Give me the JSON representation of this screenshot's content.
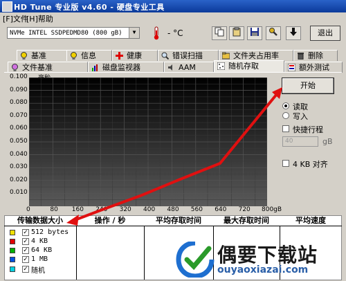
{
  "window": {
    "title": "HD Tune 专业版 v4.60 - 硬盘专业工具"
  },
  "menu": {
    "file": "[F]文件",
    "help": "[H]帮助"
  },
  "toolbar": {
    "drive": "NVMe   INTEL SSDPEDMD80 (800 gB)",
    "temperature": "- °C",
    "exit_label": "退出"
  },
  "tabs_row1": [
    {
      "label": "基准"
    },
    {
      "label": "信息"
    },
    {
      "label": "健康"
    },
    {
      "label": "错误扫描"
    },
    {
      "label": "文件夹占用率"
    },
    {
      "label": "删除"
    }
  ],
  "tabs_row2": [
    {
      "label": "文件基准"
    },
    {
      "label": "磁盘监视器"
    },
    {
      "label": "AAM"
    },
    {
      "label": "随机存取"
    },
    {
      "label": "额外测试"
    }
  ],
  "chart_data": {
    "type": "scatter",
    "ylabel": "毫秒",
    "xlabel": "",
    "y_ticks": [
      "0.100",
      "0.090",
      "0.080",
      "0.070",
      "0.060",
      "0.050",
      "0.040",
      "0.030",
      "0.020",
      "0.010"
    ],
    "x_ticks": [
      "0",
      "80",
      "160",
      "240",
      "320",
      "400",
      "480",
      "560",
      "640",
      "720",
      "800gB"
    ],
    "ylim": [
      0,
      0.1
    ],
    "xlim": [
      0,
      800
    ],
    "grid": true,
    "series": []
  },
  "controls": {
    "start_label": "开始",
    "read_label": "读取",
    "write_label": "写入",
    "quick_stroke_label": "快捷行程",
    "stroke_value": "40",
    "stroke_unit": "gB",
    "align_label": "4 KB 对齐"
  },
  "table": {
    "headers": [
      "传输数据大小",
      "操作 / 秒",
      "平均存取时间",
      "最大存取时间",
      "平均速度"
    ],
    "rows": [
      {
        "label": "512 bytes",
        "color": "#f0e000"
      },
      {
        "label": "4 KB",
        "color": "#e00000"
      },
      {
        "label": "64 KB",
        "color": "#00b000"
      },
      {
        "label": "1 MB",
        "color": "#0050e0"
      },
      {
        "label": "随机",
        "color": "#00d0e0"
      }
    ]
  },
  "watermark": {
    "text": "偶要下载站",
    "url": "ouyaoxiazai.com"
  }
}
